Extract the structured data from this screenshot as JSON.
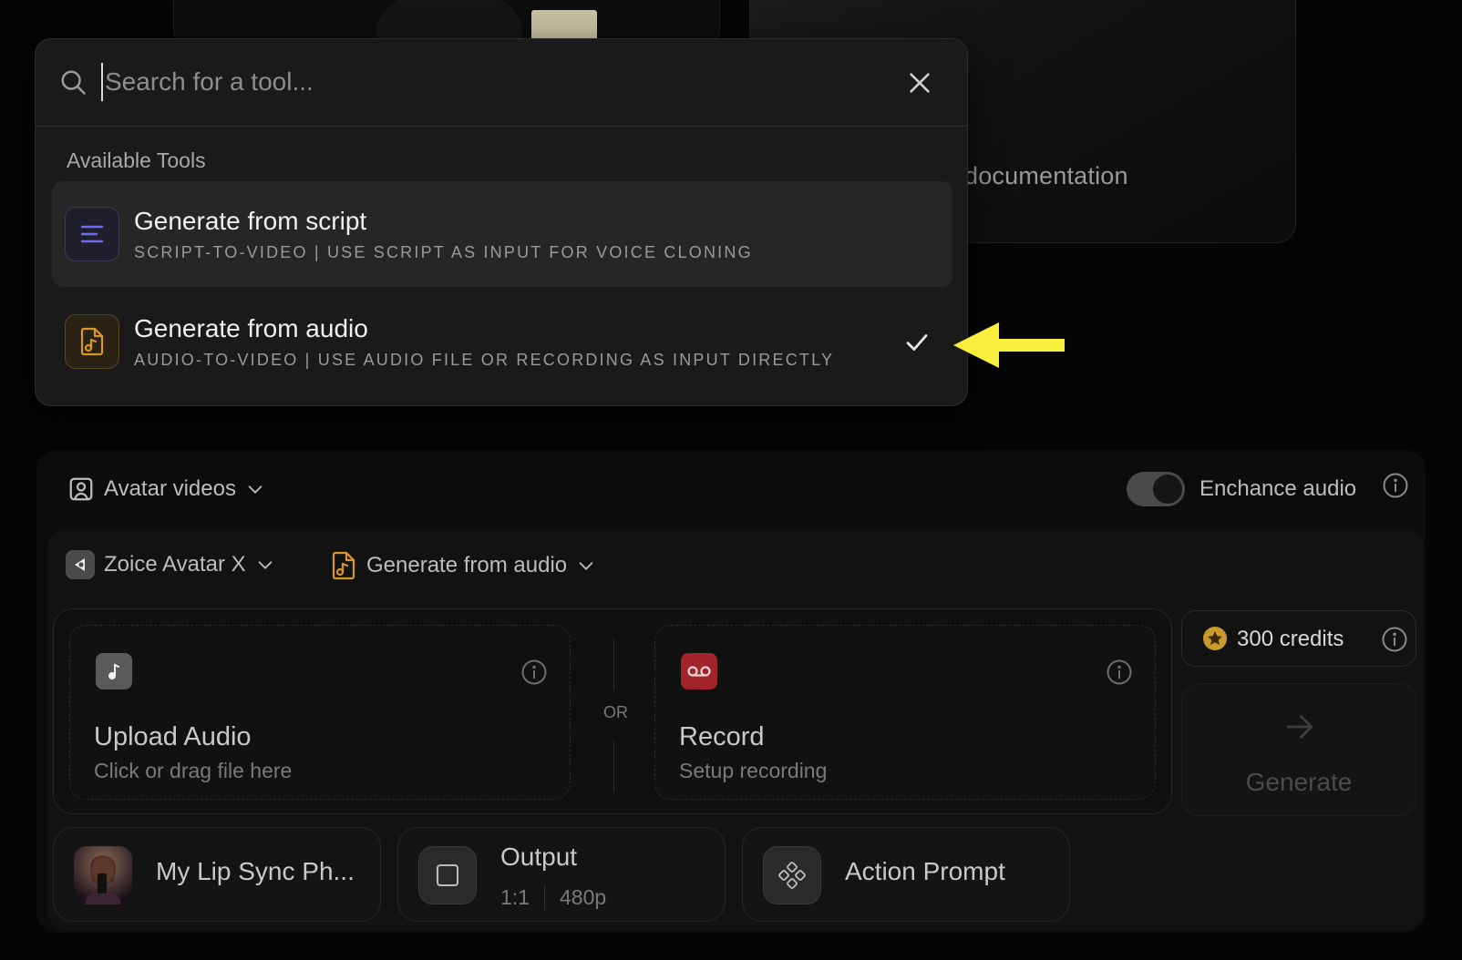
{
  "background": {
    "doc_text": "documentation"
  },
  "popup": {
    "search": {
      "placeholder": "Search for a tool...",
      "value": ""
    },
    "section_label": "Available Tools",
    "tools": [
      {
        "title": "Generate from script",
        "subtitle": "SCRIPT-TO-VIDEO | USE SCRIPT AS INPUT FOR VOICE CLONING",
        "icon": "lines-icon",
        "selected": false,
        "hovered": true
      },
      {
        "title": "Generate from audio",
        "subtitle": "AUDIO-TO-VIDEO | USE AUDIO FILE OR RECORDING AS INPUT DIRECTLY",
        "icon": "audio-file-icon",
        "selected": true,
        "hovered": false
      }
    ]
  },
  "toolbar": {
    "category": "Avatar videos",
    "enhance_audio_label": "Enchance audio",
    "enhance_audio_on": true
  },
  "generator": {
    "model": "Zoice Avatar X",
    "mode": "Generate from audio",
    "upload": {
      "title": "Upload Audio",
      "subtitle": "Click or drag file here"
    },
    "or_text": "OR",
    "record": {
      "title": "Record",
      "subtitle": "Setup recording"
    },
    "credits": "300 credits",
    "generate_label": "Generate"
  },
  "chips": {
    "avatar": {
      "label": "My Lip Sync Ph..."
    },
    "output": {
      "label": "Output",
      "ratio": "1:1",
      "resolution": "480p"
    },
    "action": {
      "label": "Action Prompt"
    }
  },
  "colors": {
    "accent_script": "#6b6bf0",
    "accent_audio": "#d9962a",
    "record_red": "#a3232a",
    "annotation_yellow": "#f7ef3c"
  }
}
